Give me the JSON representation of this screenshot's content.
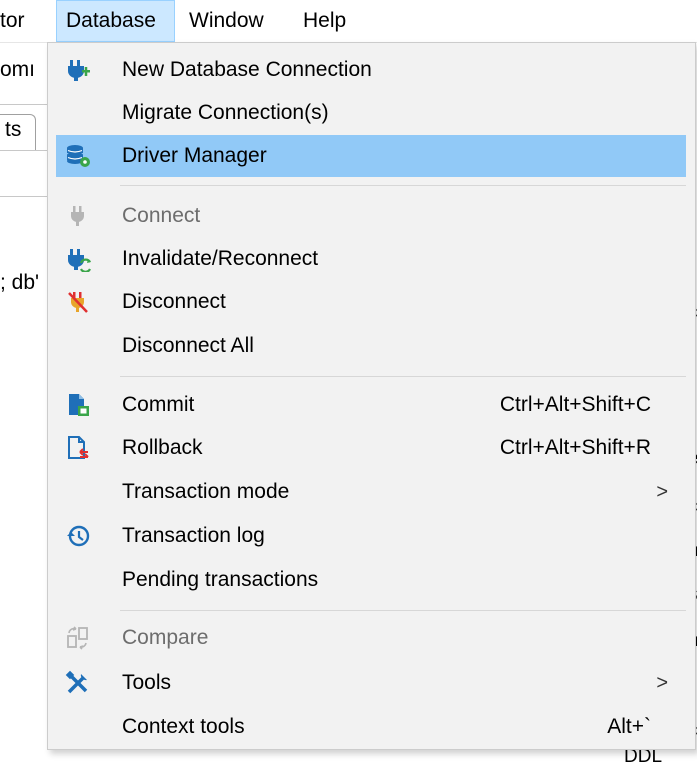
{
  "menubar": {
    "items": [
      {
        "label": "tor"
      },
      {
        "label": "Database"
      },
      {
        "label": "Window"
      },
      {
        "label": "Help"
      }
    ]
  },
  "background": {
    "toolbar_fragment": "omı",
    "tab_fragment": "ts",
    "editor_fragment": "; db'",
    "right_chars": [
      "(",
      "r",
      "t",
      "r",
      "c",
      "r",
      "e",
      "c",
      "n",
      "s",
      "n",
      "r",
      "c"
    ],
    "bottom_fragment": "DDL"
  },
  "menu": {
    "items": [
      {
        "label": "New Database Connection",
        "icon": "plug-add-icon"
      },
      {
        "label": "Migrate Connection(s)"
      },
      {
        "label": "Driver Manager",
        "icon": "database-gear-icon"
      },
      {
        "label": "Connect",
        "icon": "plug-icon"
      },
      {
        "label": "Invalidate/Reconnect",
        "icon": "plug-refresh-icon"
      },
      {
        "label": "Disconnect",
        "icon": "plug-disconnect-icon"
      },
      {
        "label": "Disconnect All"
      },
      {
        "label": "Commit",
        "icon": "commit-icon",
        "shortcut": "Ctrl+Alt+Shift+C"
      },
      {
        "label": "Rollback",
        "icon": "rollback-icon",
        "shortcut": "Ctrl+Alt+Shift+R"
      },
      {
        "label": "Transaction mode"
      },
      {
        "label": "Transaction log",
        "icon": "history-icon"
      },
      {
        "label": "Pending transactions"
      },
      {
        "label": "Compare",
        "icon": "compare-icon"
      },
      {
        "label": "Tools",
        "icon": "tools-icon"
      },
      {
        "label": "Context tools",
        "shortcut": "Alt+`"
      }
    ],
    "submenu_arrow": ">"
  },
  "colors": {
    "highlight": "#91c9f7",
    "menubar_active": "#cce8ff",
    "menu_bg": "#f2f2f2",
    "icon_blue": "#1f6fb8",
    "icon_green": "#3aa54a",
    "icon_red": "#e03030"
  }
}
